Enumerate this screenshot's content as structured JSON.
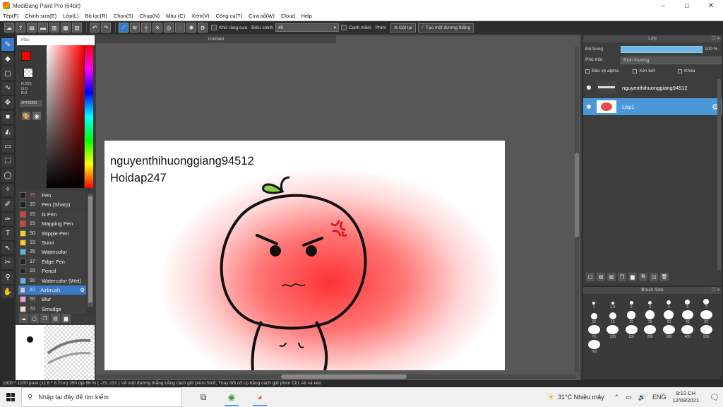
{
  "window": {
    "title": "MediBang Paint Pro (64bit)",
    "controls": [
      "–",
      "□",
      "✕"
    ]
  },
  "menu": [
    "Tệp(F)",
    "Chỉnh sửa(E)",
    "Lớp(L)",
    "Bộ lọc(R)",
    "Chọn(S)",
    "Chụp(N)",
    "Màu (C)",
    "Xem(V)",
    "Công cụ(T)",
    "Cửa sổ(W)",
    "Cloud",
    "Help"
  ],
  "toolbar": {
    "antialias_label": "Khử răng cưa",
    "adjust_label": "Điều chỉnh",
    "adjust_value": "40",
    "smooth_label": "Canh mềm",
    "key_label": "Phím",
    "reset_label": "Đặt lại",
    "line_label": "Tạo một đường thẳng"
  },
  "color_panel": {
    "tab": "Màu",
    "rgb": "R:255\nG:0\nB:0",
    "hex": "#FF0000",
    "foreground": "#ff0000"
  },
  "brushes": [
    {
      "size": "15",
      "name": "Pen",
      "color": "#222222"
    },
    {
      "size": "10",
      "name": "Pen (Sharp)",
      "color": "#222222"
    },
    {
      "size": "15",
      "name": "G Pen",
      "color": "#e23b3b"
    },
    {
      "size": "15",
      "name": "Mapping Pen",
      "color": "#e23b3b"
    },
    {
      "size": "50",
      "name": "Stipple Pen",
      "color": "#f3d21a"
    },
    {
      "size": "19",
      "name": "Sumi",
      "color": "#f3d21a"
    },
    {
      "size": "35",
      "name": "Watercolor",
      "color": "#5ab9e8"
    },
    {
      "size": "17",
      "name": "Edge Pen",
      "color": "#222222"
    },
    {
      "size": "20",
      "name": "Pencil",
      "color": "#222222"
    },
    {
      "size": "90",
      "name": "Watercolor (Wet)",
      "color": "#5ab9e8"
    },
    {
      "size": "30",
      "name": "Airbrush",
      "color": "#cccccc"
    },
    {
      "size": "50",
      "name": "Blur",
      "color": "#e69de6"
    },
    {
      "size": "70",
      "name": "Smudge",
      "color": "#f1d9c2"
    }
  ],
  "document": {
    "tab": "Untitled",
    "text_line1": "nguyenthihuonggiang94512",
    "text_line2": "Hoidap247"
  },
  "layer_panel": {
    "title": "Lớp",
    "opacity_label": "Độ trong",
    "opacity_value": "100 %",
    "opacity_fraction": 1.0,
    "blend_label": "Phủ trộn",
    "blend_value": "Bình thường",
    "protect_alpha": "Bảo vệ alpha",
    "clip": "Xén bớt",
    "lock": "Khóa",
    "layers": [
      {
        "name": "nguyenthihuonggiang94512",
        "selected": false
      },
      {
        "name": "Lớp1",
        "selected": true
      }
    ]
  },
  "brush_size": {
    "title": "Brush Size",
    "sizes": [
      "1",
      "1.5",
      "2",
      "3",
      "4",
      "5",
      "7",
      "10",
      "15",
      "20",
      "25",
      "30",
      "40",
      "50",
      "70",
      "100",
      "150",
      "200",
      "300",
      "400",
      "500",
      "700"
    ]
  },
  "status": "1600 * 1200 pixel  (11.6 * 8.7cm)  350 dpi  66 %  ( -23, 231 )  Vẽ một đường thẳng bằng cách giữ phím Shift, Thay đổi cỡ cọ bằng cách giữ phím Ctrl, Alt và kéo",
  "taskbar": {
    "search_placeholder": "Nhập tại đây để tìm kiếm",
    "weather": "31°C  Nhiều mây",
    "lang": "ENG",
    "time": "8:13 CH",
    "date": "12/09/2021"
  }
}
